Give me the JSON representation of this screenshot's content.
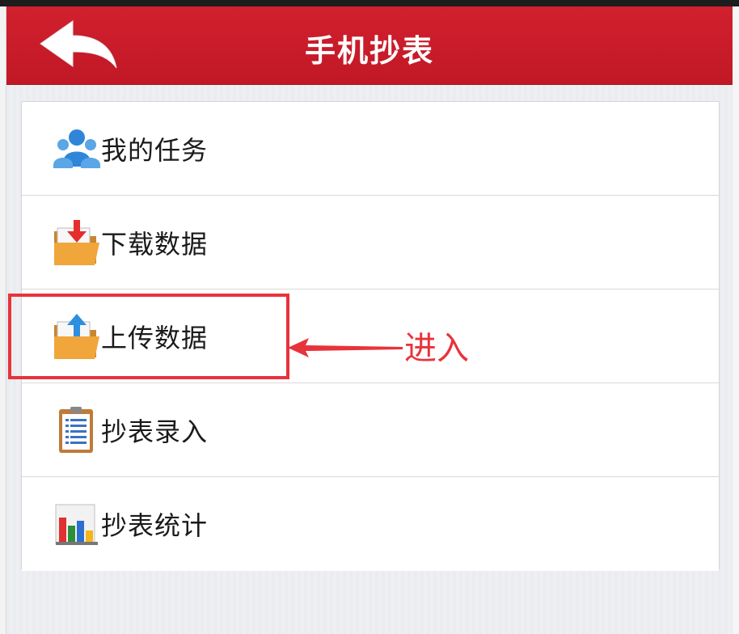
{
  "header": {
    "title": "手机抄表",
    "back_icon": "back-arrow-icon"
  },
  "menu": {
    "items": [
      {
        "label": "我的任务",
        "icon": "users-icon"
      },
      {
        "label": "下载数据",
        "icon": "folder-download-icon"
      },
      {
        "label": "上传数据",
        "icon": "folder-upload-icon"
      },
      {
        "label": "抄表录入",
        "icon": "clipboard-icon"
      },
      {
        "label": "抄表统计",
        "icon": "bar-chart-icon"
      }
    ]
  },
  "annotation": {
    "text": "进入",
    "color": "#e8333a"
  },
  "colors": {
    "header": "#c81c2a",
    "background": "#eeeff2"
  }
}
